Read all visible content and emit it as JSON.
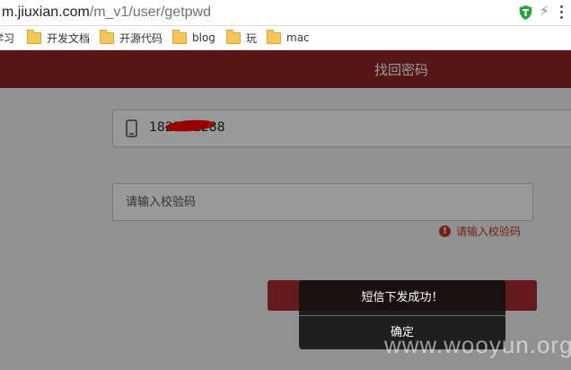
{
  "browser": {
    "url_host": "m.jiuxian.com",
    "url_path": "/m_v1/user/getpwd",
    "bookmarks": [
      {
        "label": "学习",
        "icon": "folder-icon"
      },
      {
        "label": "开发文档",
        "icon": "folder-icon"
      },
      {
        "label": "开源代码",
        "icon": "folder-icon"
      },
      {
        "label": "blog",
        "icon": "folder-icon"
      },
      {
        "label": "玩",
        "icon": "folder-icon"
      },
      {
        "label": "mac",
        "icon": "folder-icon"
      }
    ]
  },
  "page": {
    "title": "找回密码",
    "phone_value": "18230  1288",
    "code_placeholder": "请输入校验码",
    "code_error": "请输入校验码"
  },
  "dialog": {
    "message": "短信下发成功！",
    "confirm_label": "确定"
  },
  "watermark": "www.wooyun.org",
  "colors": {
    "header": "#8e2525",
    "accent": "#a82d2d",
    "error": "#c0392b"
  }
}
